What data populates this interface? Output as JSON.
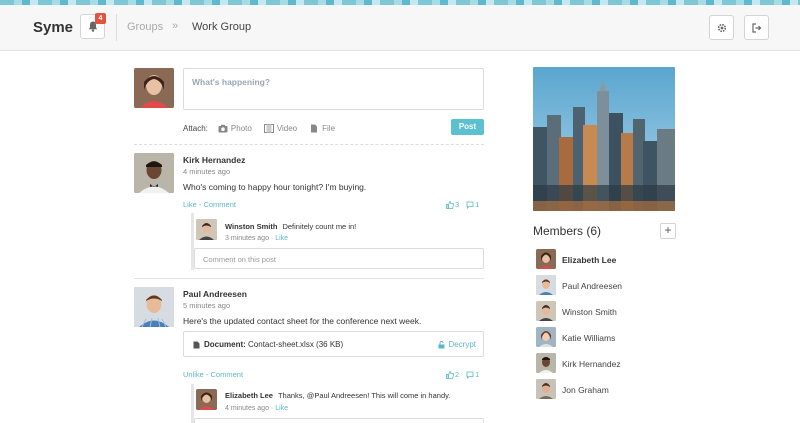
{
  "app": {
    "logo": "Syme",
    "notification_count": "4"
  },
  "breadcrumb": {
    "groups": "Groups",
    "separator": "»",
    "current": "Work Group"
  },
  "composer": {
    "placeholder": "What's happening?",
    "attach_label": "Attach:",
    "attach_photo": "Photo",
    "attach_video": "Video",
    "attach_file": "File",
    "post_button": "Post"
  },
  "posts": [
    {
      "author": "Kirk Hernandez",
      "time": "4 minutes ago",
      "text": "Who's coming to happy hour tonight? I'm buying.",
      "actions": {
        "like": "Like",
        "separator": " - ",
        "comment": "Comment"
      },
      "likes": "3",
      "comments": "1",
      "replies": [
        {
          "author": "Winston Smith",
          "text": "Definitely count me in!",
          "time": "3 minutes ago",
          "like": "Like"
        }
      ],
      "comment_placeholder": "Comment on this post"
    },
    {
      "author": "Paul Andreesen",
      "time": "5 minutes ago",
      "text": "Here's the updated contact sheet for the conference next week.",
      "attachment": {
        "label": "Document:",
        "filename": "Contact-sheet.xlsx (36 KB)",
        "action": "Decrypt"
      },
      "actions": {
        "like": "Unlike",
        "separator": " - ",
        "comment": "Comment"
      },
      "likes": "2",
      "comments": "1",
      "replies": [
        {
          "author": "Elizabeth Lee",
          "text_before": "Thanks, ",
          "mention": "@Paul Andreesen",
          "text_after": "! This will come in handy.",
          "time": "4 minutes ago",
          "like": "Like"
        }
      ]
    }
  ],
  "sidebar": {
    "members_title": "Members (6)",
    "add_member": "+",
    "members": [
      {
        "name": "Elizabeth Lee"
      },
      {
        "name": "Paul Andreesen"
      },
      {
        "name": "Winston Smith"
      },
      {
        "name": "Katie Williams"
      },
      {
        "name": "Kirk Hernandez"
      },
      {
        "name": "Jon Graham"
      }
    ]
  },
  "colors": {
    "accent": "#5bc0cf",
    "badge": "#e2543f",
    "link": "#5bb7c8"
  }
}
